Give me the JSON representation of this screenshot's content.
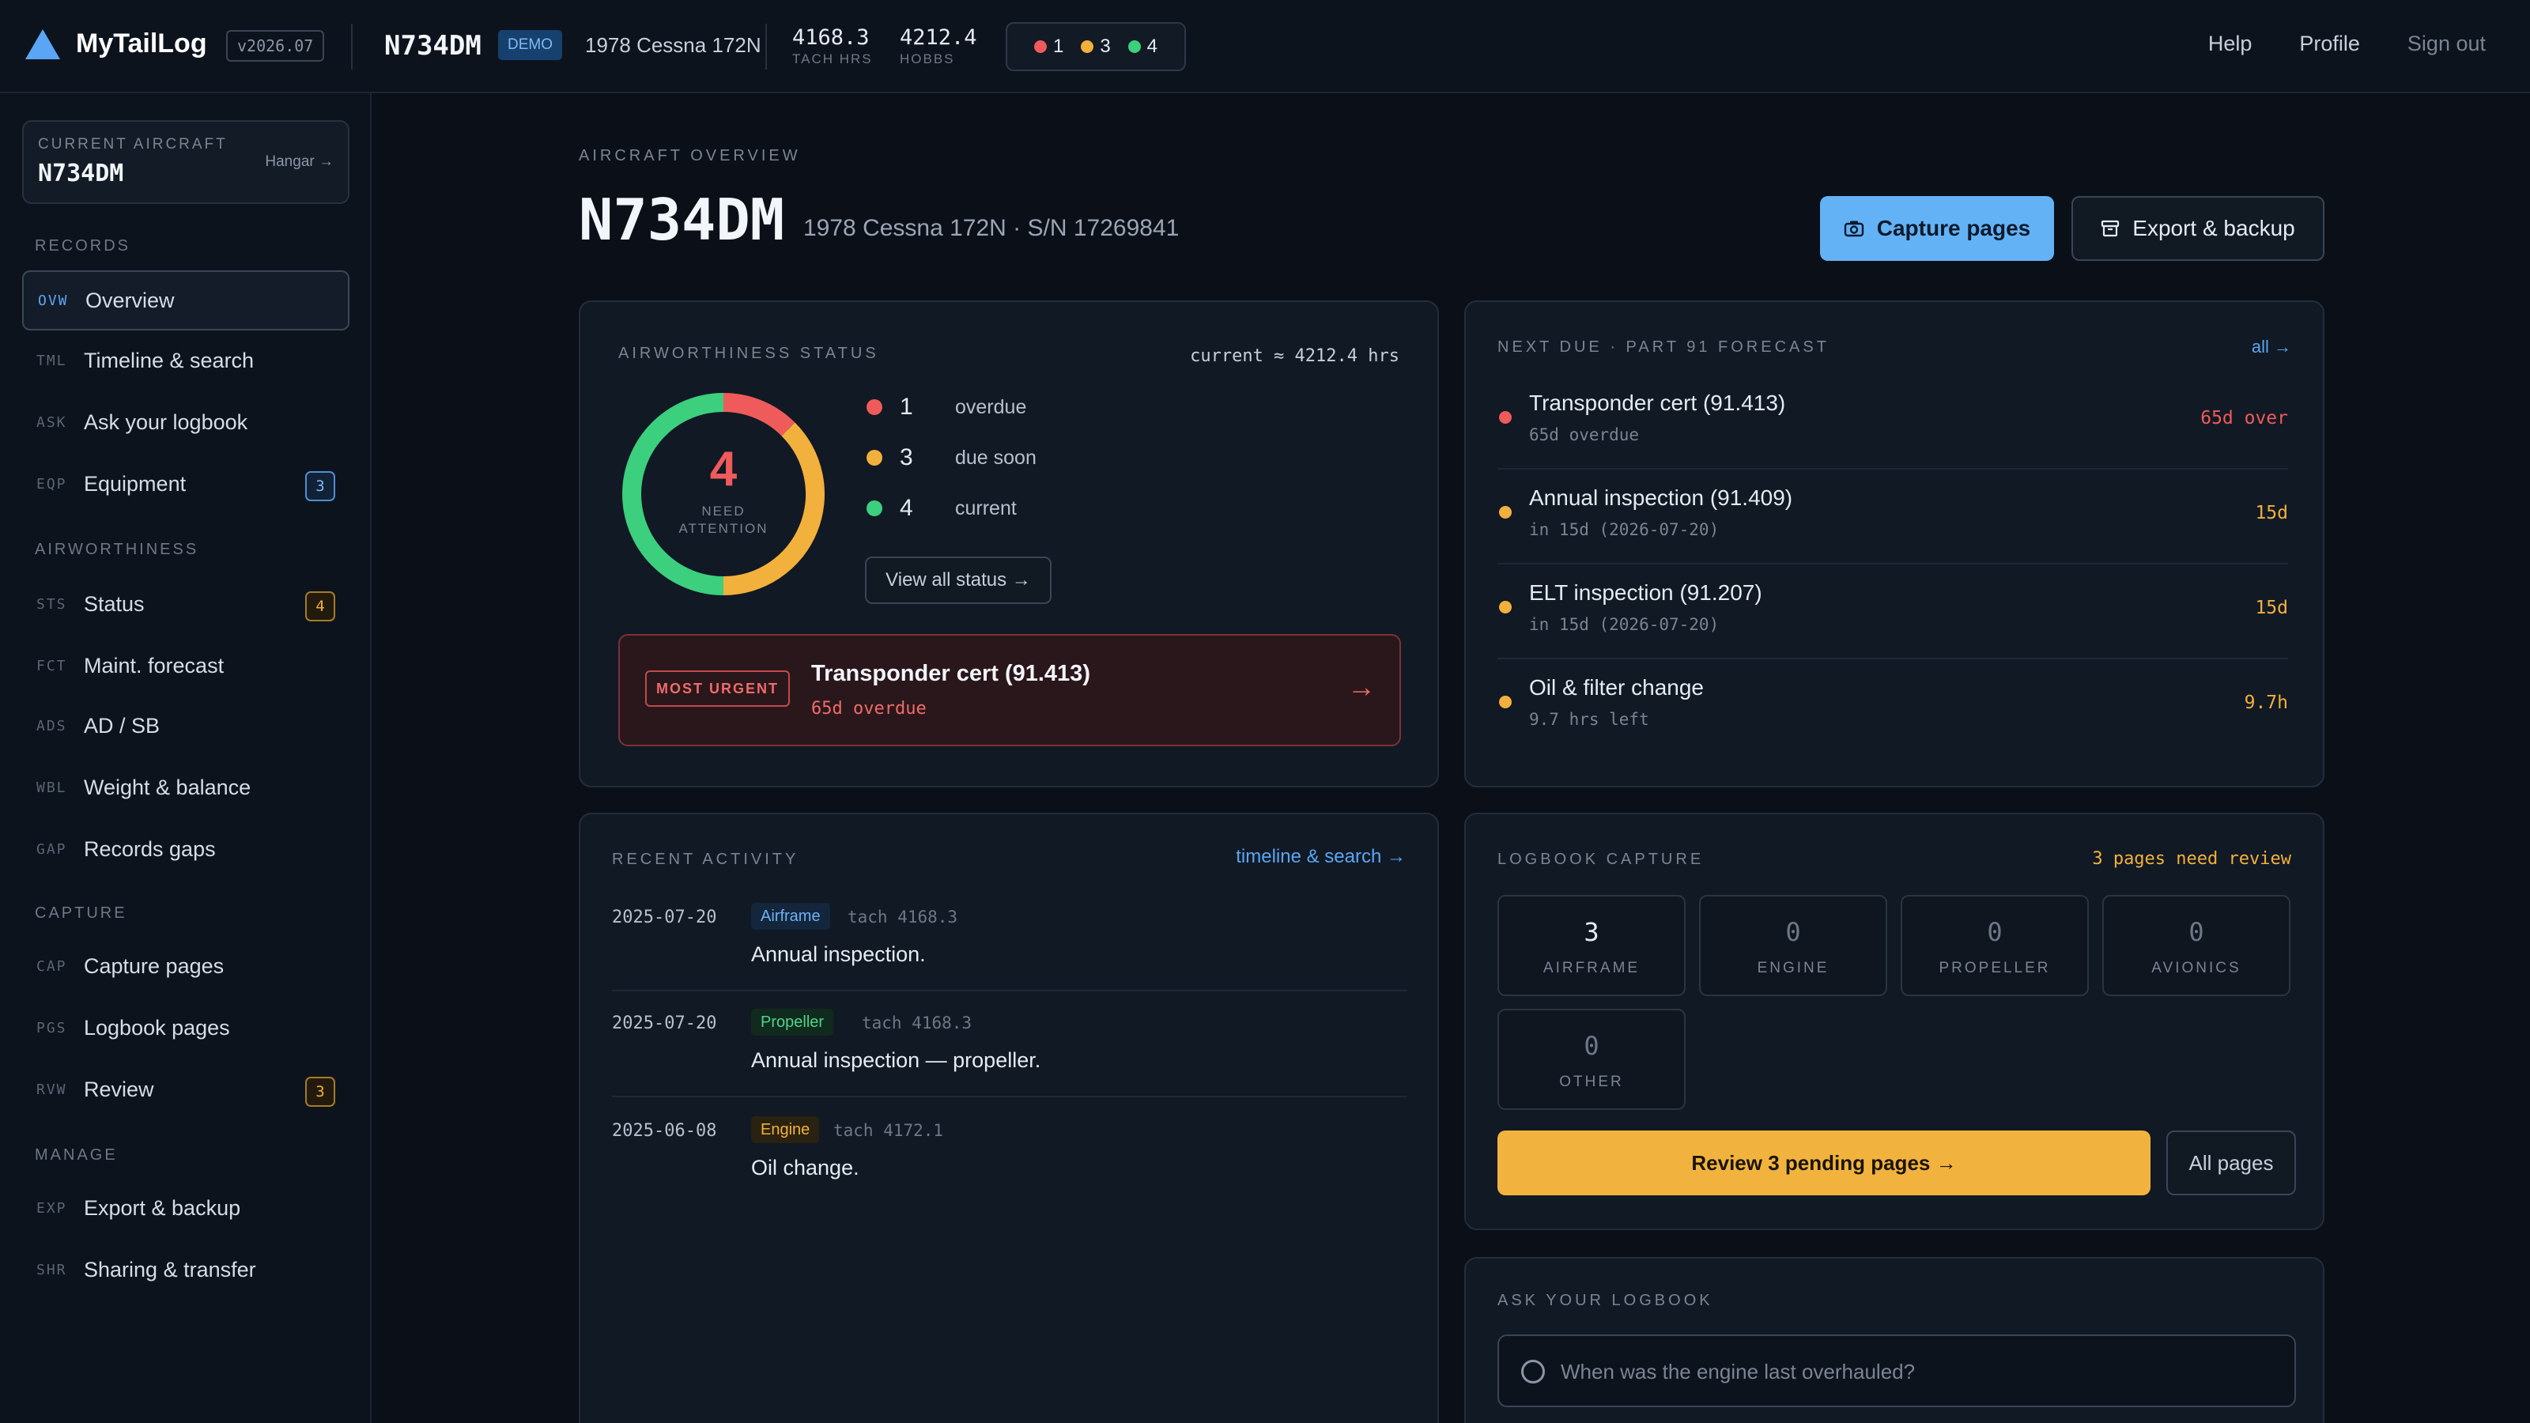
{
  "topbar": {
    "app_name": "MyTailLog",
    "version": "v2026.07",
    "tail": "N734DM",
    "demo": "DEMO",
    "aircraft": "1978 Cessna 172N",
    "tach": {
      "value": "4168.3",
      "label": "TACH HRS"
    },
    "hobbs": {
      "value": "4212.4",
      "label": "HOBBS"
    },
    "status": {
      "overdue": "1",
      "due_soon": "3",
      "current": "4"
    },
    "nav": {
      "help": "Help",
      "profile": "Profile",
      "signout": "Sign out"
    }
  },
  "sidebar": {
    "current": {
      "label": "CURRENT AIRCRAFT",
      "tail": "N734DM",
      "hangar": "Hangar →"
    },
    "sections": {
      "records": "RECORDS",
      "airworthiness": "AIRWORTHINESS",
      "capture": "CAPTURE",
      "manage": "MANAGE"
    },
    "items": [
      {
        "code": "OVW",
        "label": "Overview"
      },
      {
        "code": "TML",
        "label": "Timeline & search"
      },
      {
        "code": "ASK",
        "label": "Ask your logbook"
      },
      {
        "code": "EQP",
        "label": "Equipment",
        "count": "3"
      },
      {
        "code": "STS",
        "label": "Status",
        "count": "4"
      },
      {
        "code": "FCT",
        "label": "Maint. forecast"
      },
      {
        "code": "ADS",
        "label": "AD / SB"
      },
      {
        "code": "WBL",
        "label": "Weight & balance"
      },
      {
        "code": "GAP",
        "label": "Records gaps"
      },
      {
        "code": "CAP",
        "label": "Capture pages"
      },
      {
        "code": "PGS",
        "label": "Logbook pages"
      },
      {
        "code": "RVW",
        "label": "Review",
        "count": "3"
      },
      {
        "code": "EXP",
        "label": "Export & backup"
      },
      {
        "code": "SHR",
        "label": "Sharing & transfer"
      }
    ]
  },
  "main": {
    "eyebrow": "AIRCRAFT OVERVIEW",
    "title": "N734DM",
    "subtitle": "1978 Cessna 172N · S/N 17269841",
    "capture_btn": "Capture pages",
    "export_btn": "Export & backup"
  },
  "airworthiness": {
    "title": "AIRWORTHINESS STATUS",
    "current_hrs": "current ≈ 4212.4 hrs",
    "need_count": "4",
    "need_label_1": "NEED",
    "need_label_2": "ATTENTION",
    "overdue": 1,
    "due_soon": 3,
    "current": 4,
    "legend": [
      {
        "n": "1",
        "label": "overdue"
      },
      {
        "n": "3",
        "label": "due soon"
      },
      {
        "n": "4",
        "label": "current"
      }
    ],
    "view_all": "View all status →",
    "urgent": {
      "badge": "MOST URGENT",
      "title": "Transponder cert (91.413)",
      "sub": "65d overdue"
    },
    "colors": {
      "overdue": "#ef5b5b",
      "due_soon": "#f2b03c",
      "current": "#3ccf7e"
    }
  },
  "next_due": {
    "title": "NEXT DUE · PART 91 FORECAST",
    "all_link": "all →",
    "items": [
      {
        "title": "Transponder cert (91.413)",
        "sub": "65d overdue",
        "value": "65d over",
        "status": "overdue"
      },
      {
        "title": "Annual inspection (91.409)",
        "sub": "in 15d (2026-07-20)",
        "value": "15d",
        "status": "soon"
      },
      {
        "title": "ELT inspection (91.207)",
        "sub": "in 15d (2026-07-20)",
        "value": "15d",
        "status": "soon"
      },
      {
        "title": "Oil & filter change",
        "sub": "9.7 hrs left",
        "value": "9.7h",
        "status": "soon"
      }
    ]
  },
  "recent": {
    "title": "RECENT ACTIVITY",
    "link": "timeline & search →",
    "items": [
      {
        "date": "2025-07-20",
        "tag": "Airframe",
        "tach": "tach 4168.3",
        "desc": "Annual inspection."
      },
      {
        "date": "2025-07-20",
        "tag": "Propeller",
        "tach": "tach 4168.3",
        "desc": "Annual inspection — propeller."
      },
      {
        "date": "2025-06-08",
        "tag": "Engine",
        "tach": "tach 4172.1",
        "desc": "Oil change."
      }
    ]
  },
  "capture": {
    "title": "LOGBOOK CAPTURE",
    "note": "3 pages need review",
    "tiles": [
      {
        "n": "3",
        "label": "AIRFRAME"
      },
      {
        "n": "0",
        "label": "ENGINE"
      },
      {
        "n": "0",
        "label": "PROPELLER"
      },
      {
        "n": "0",
        "label": "AVIONICS"
      },
      {
        "n": "0",
        "label": "OTHER"
      }
    ],
    "review_btn": "Review 3 pending pages →",
    "all_pages_btn": "All pages"
  },
  "ask": {
    "title": "ASK YOUR LOGBOOK",
    "placeholder": "When was the engine last overhauled?"
  }
}
